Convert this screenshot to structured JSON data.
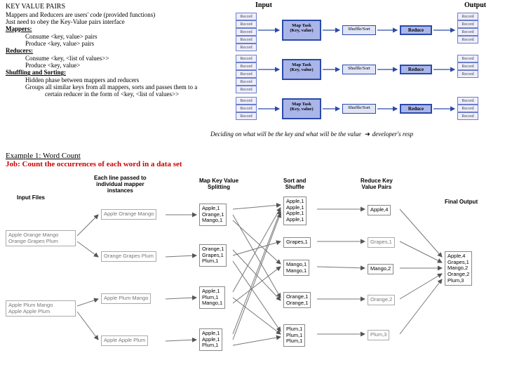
{
  "top": {
    "title": "KEY VALUE PAIRS",
    "line1": "Mappers and Reducers are users' code (provided functions)",
    "line2": "Just need to obey the Key-Value pairs interface",
    "mappers_h": "Mappers:",
    "mappers_l1": "Consume <key, value> pairs",
    "mappers_l2": "Produce <key, value> pairs",
    "reducers_h": "Reducers:",
    "reducers_l1": "Consume <key, <list of values>>",
    "reducers_l2": "Produce <key, value>",
    "shuffle_h": "Shuffling and Sorting:",
    "shuffle_l1": "Hidden phase between mappers and reducers",
    "shuffle_l2": "Groups all similar keys from all mappers, sorts and passes them to a",
    "shuffle_l3": "certain reducer in the form of <key, <list of values>>"
  },
  "diagram_top": {
    "input": "Input",
    "output": "Output",
    "record": "Record",
    "maptask": "Map Task\n(Key, value)",
    "shufflesort": "Shuffle/Sort",
    "reduce": "Reduce"
  },
  "caption": {
    "pre": "Deciding on what will be the key and what will be the value ",
    "post": "developer's resp"
  },
  "example": {
    "title": "Example 1: Word Count",
    "job": "Job: Count the occurrences of each word in a data set"
  },
  "wc": {
    "col_input": "Input Files",
    "col_split": "Each line passed to\nindividual mapper\ninstances",
    "col_map": "Map Key Value\nSplitting",
    "col_sort": "Sort and\nShuffle",
    "col_reduce": "Reduce Key\nValue Pairs",
    "col_final": "Final Output",
    "input_box1": "Apple Orange Mango\nOrange Grapes Plum",
    "input_box2": "Apple Plum Mango\nApple Apple Plum",
    "split1": "Apple Orange Mango",
    "split2": "Orange Grapes Plum",
    "split3": "Apple Plum Mango",
    "split4": "Apple Apple Plum",
    "map1": "Apple,1\nOrange,1\nMango,1",
    "map2": "Orange,1\nGrapes,1\nPlum,1",
    "map3": "Apple,1\nPlum,1\nMango,1",
    "map4": "Apple,1\nApple,1\nPlum,1",
    "sort1": "Apple,1\nApple,1\nApple,1\nApple,1",
    "sort2": "Grapes,1",
    "sort3": "Mango,1\nMango,1",
    "sort4": "Orange,1\nOrange,1",
    "sort5": "Plum,1\nPlum,1\nPlum,1",
    "red1": "Apple,4",
    "red2": "Grapes,1",
    "red3": "Mango,2",
    "red4": "Orange,2",
    "red5": "Plum,3",
    "final": "Apple,4\nGrapes,1\nMango,2\nOrange,2\nPlum,3"
  }
}
